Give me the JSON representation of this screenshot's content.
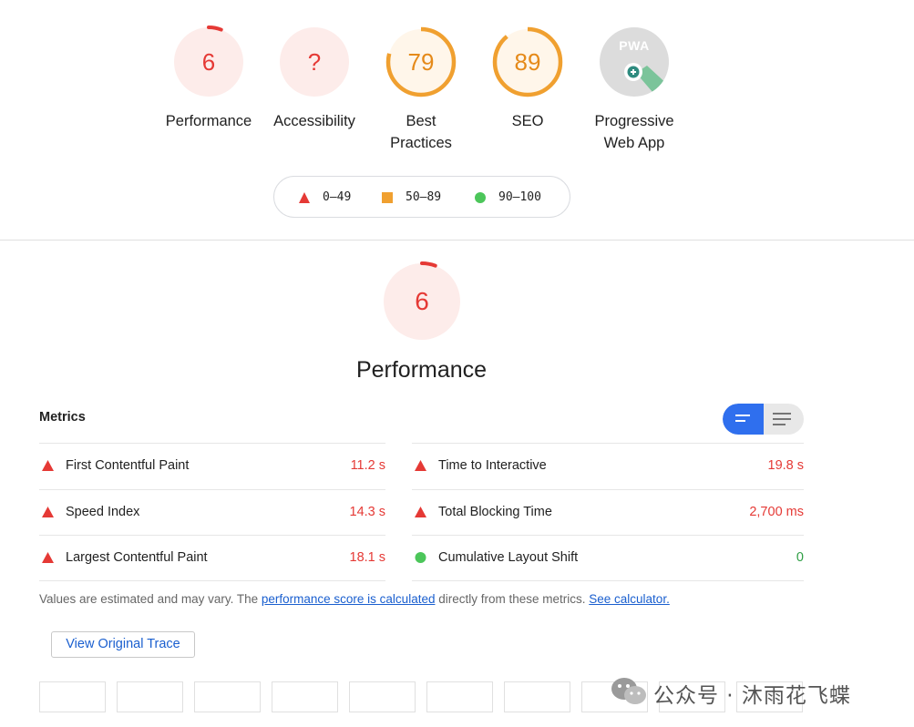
{
  "colors": {
    "fail": "#e53935",
    "average": "#f0a030",
    "pass": "#4cc65a",
    "link": "#1a5fcf",
    "accent": "#2f6fee"
  },
  "categories": [
    {
      "label": "Performance",
      "value": "6",
      "score": 6,
      "status": "fail"
    },
    {
      "label": "Accessibility",
      "value": "?",
      "score": null,
      "status": "fail"
    },
    {
      "label": "Best Practices",
      "value": "79",
      "score": 79,
      "status": "average"
    },
    {
      "label": "SEO",
      "value": "89",
      "score": 89,
      "status": "average"
    },
    {
      "label": "Progressive Web App",
      "value": "",
      "score": null,
      "status": "pwa",
      "badge_text": "PWA"
    }
  ],
  "legend": [
    {
      "range": "0–49",
      "icon": "triangle-icon"
    },
    {
      "range": "50–89",
      "icon": "square-icon"
    },
    {
      "range": "90–100",
      "icon": "circle-icon"
    }
  ],
  "performance": {
    "title": "Performance",
    "value": "6",
    "score": 6
  },
  "metrics": {
    "heading": "Metrics",
    "left": [
      {
        "name": "First Contentful Paint",
        "value": "11.2 s",
        "status": "fail"
      },
      {
        "name": "Speed Index",
        "value": "14.3 s",
        "status": "fail"
      },
      {
        "name": "Largest Contentful Paint",
        "value": "18.1 s",
        "status": "fail"
      }
    ],
    "right": [
      {
        "name": "Time to Interactive",
        "value": "19.8 s",
        "status": "fail"
      },
      {
        "name": "Total Blocking Time",
        "value": "2,700 ms",
        "status": "fail"
      },
      {
        "name": "Cumulative Layout Shift",
        "value": "0",
        "status": "pass"
      }
    ]
  },
  "note": {
    "prefix": "Values are estimated and may vary. The ",
    "link1": "performance score is calculated",
    "middle": " directly from these metrics. ",
    "link2": "See calculator."
  },
  "trace_button": "View Original Trace",
  "watermark": "公众号 · 沐雨花飞蝶"
}
